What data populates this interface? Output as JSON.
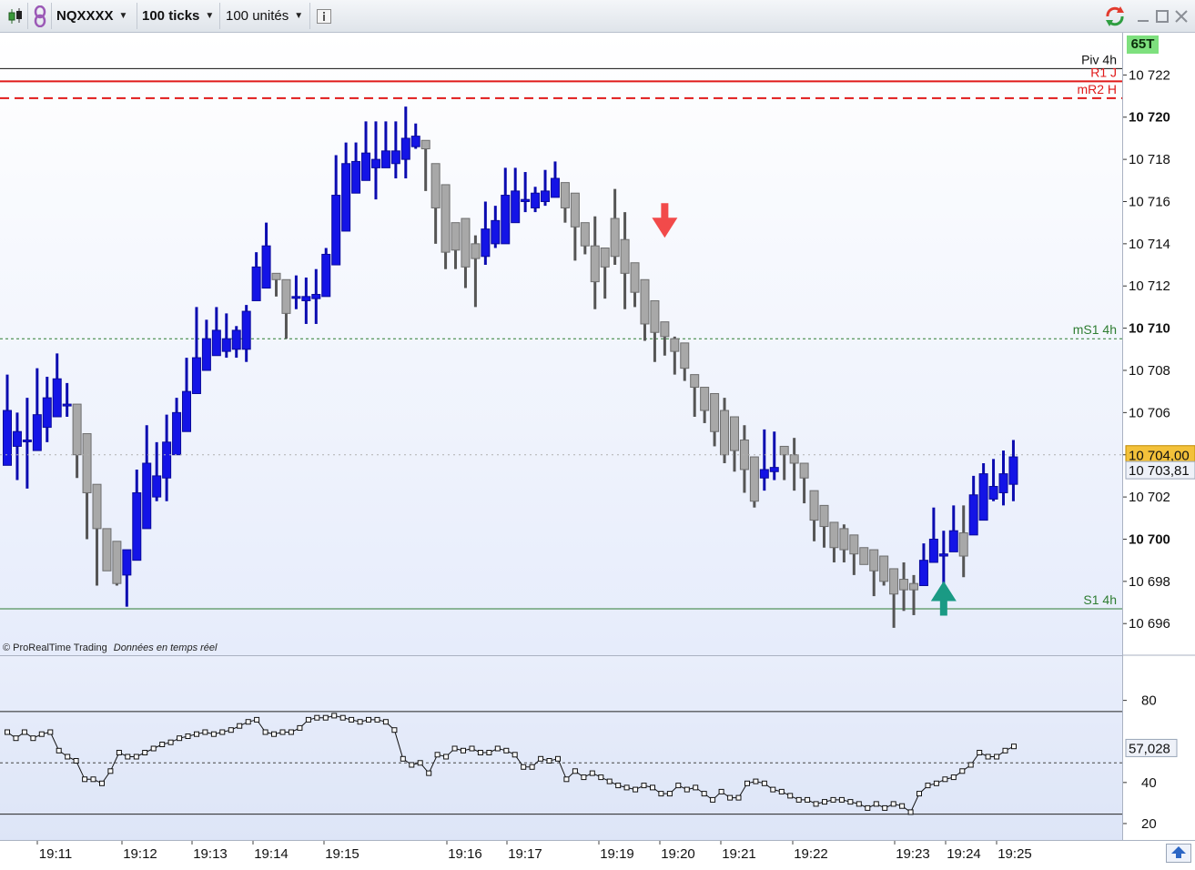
{
  "toolbar": {
    "instrument": "NQXXXX",
    "bar_type": "100 ticks",
    "volume_units": "100 unités",
    "info_icon": "info-icon",
    "chart_type_icon": "candlestick-icon",
    "link_icon": "link-icon",
    "refresh_icon": "refresh-icon",
    "minimize_icon": "minimize-icon",
    "maximize_icon": "maximize-icon",
    "close_icon": "close-icon"
  },
  "tick_count_badge": "65T",
  "colors": {
    "up_candle": "#1414e6",
    "down_candle": "#a8a8a8",
    "pivot_line": "#111111",
    "r1_line": "#e01a1a",
    "ms1_line": "#2e7d32",
    "current_price_bg": "#f3c13a"
  },
  "levels": [
    {
      "label": "Piv 4h",
      "value": 10722.3,
      "color": "#111111",
      "style": "solid"
    },
    {
      "label": "R1 J",
      "value": 10721.7,
      "color": "#e01a1a",
      "style": "solid"
    },
    {
      "label": "mR2 H",
      "value": 10720.9,
      "color": "#e01a1a",
      "style": "dashed"
    },
    {
      "label": "mS1 4h",
      "value": 10709.5,
      "color": "#2e7d32",
      "style": "dotted"
    },
    {
      "label": "S1 4h",
      "value": 10696.7,
      "color": "#2e7d32",
      "style": "solid"
    }
  ],
  "price_axis": {
    "min": 10694.5,
    "max": 10724.0,
    "ticks": [
      {
        "value": 10722,
        "label": "10 722",
        "bold": false
      },
      {
        "value": 10720,
        "label": "10 720",
        "bold": true
      },
      {
        "value": 10718,
        "label": "10 718",
        "bold": false
      },
      {
        "value": 10716,
        "label": "10 716",
        "bold": false
      },
      {
        "value": 10714,
        "label": "10 714",
        "bold": false
      },
      {
        "value": 10712,
        "label": "10 712",
        "bold": false
      },
      {
        "value": 10710,
        "label": "10 710",
        "bold": true
      },
      {
        "value": 10708,
        "label": "10 708",
        "bold": false
      },
      {
        "value": 10706,
        "label": "10 706",
        "bold": false
      },
      {
        "value": 10704,
        "label": "10 704",
        "bold": false
      },
      {
        "value": 10702,
        "label": "10 702",
        "bold": false
      },
      {
        "value": 10700,
        "label": "10 700",
        "bold": true
      },
      {
        "value": 10698,
        "label": "10 698",
        "bold": false
      },
      {
        "value": 10696,
        "label": "10 696",
        "bold": false
      }
    ],
    "current_price_label": "10 704,00",
    "current_price_value": 10704.0,
    "secondary_price_label": "10 703,81",
    "secondary_price_value": 10703.81
  },
  "rsi_axis": {
    "min": 12,
    "max": 102,
    "ticks": [
      {
        "value": 80,
        "label": "80"
      },
      {
        "value": 40,
        "label": "40"
      },
      {
        "value": 20,
        "label": "20"
      }
    ],
    "upper_band": 75,
    "lower_band": 25,
    "mid_line": 50,
    "current_value_label": "57,028",
    "current_value": 57.028
  },
  "time_axis": {
    "labels": [
      "19:11",
      "19:12",
      "19:13",
      "19:14",
      "19:15",
      "19:16",
      "19:17",
      "19:19",
      "19:20",
      "19:21",
      "19:22",
      "19:23",
      "19:24",
      "19:25"
    ]
  },
  "copyright": "© ProRealTime Trading",
  "data_status": "Données en temps réel",
  "annotations": [
    {
      "type": "arrow-down",
      "color": "#f24a4a",
      "bar_index": 66,
      "price": 10714.5
    },
    {
      "type": "arrow-up",
      "color": "#1a9a84",
      "bar_index": 94,
      "price": 10697.5
    }
  ],
  "chart_data": {
    "type": "candlestick",
    "title": "NQXXXX",
    "bar_interval": "100 ticks",
    "candles": [
      {
        "o": 10703.5,
        "h": 10707.8,
        "l": 10703.5,
        "c": 10706.1
      },
      {
        "o": 10704.4,
        "h": 10706.0,
        "l": 10702.8,
        "c": 10705.1
      },
      {
        "o": 10704.7,
        "h": 10706.7,
        "l": 10702.4,
        "c": 10704.7
      },
      {
        "o": 10704.2,
        "h": 10708.1,
        "l": 10704.2,
        "c": 10705.9
      },
      {
        "o": 10705.3,
        "h": 10707.7,
        "l": 10704.6,
        "c": 10706.7
      },
      {
        "o": 10705.8,
        "h": 10708.8,
        "l": 10705.8,
        "c": 10707.6
      },
      {
        "o": 10706.4,
        "h": 10707.4,
        "l": 10705.8,
        "c": 10706.4
      },
      {
        "o": 10706.4,
        "h": 10706.4,
        "l": 10702.9,
        "c": 10704.0
      },
      {
        "o": 10705.0,
        "h": 10705.0,
        "l": 10700.0,
        "c": 10702.2
      },
      {
        "o": 10702.6,
        "h": 10702.6,
        "l": 10697.8,
        "c": 10700.5
      },
      {
        "o": 10700.5,
        "h": 10700.5,
        "l": 10698.8,
        "c": 10698.5
      },
      {
        "o": 10699.9,
        "h": 10699.9,
        "l": 10697.8,
        "c": 10697.9
      },
      {
        "o": 10698.3,
        "h": 10699.5,
        "l": 10696.8,
        "c": 10699.5
      },
      {
        "o": 10699.0,
        "h": 10703.3,
        "l": 10699.0,
        "c": 10702.2
      },
      {
        "o": 10700.5,
        "h": 10705.4,
        "l": 10700.5,
        "c": 10703.6
      },
      {
        "o": 10702.0,
        "h": 10704.6,
        "l": 10701.8,
        "c": 10703.0
      },
      {
        "o": 10702.9,
        "h": 10705.9,
        "l": 10701.8,
        "c": 10704.6
      },
      {
        "o": 10704.0,
        "h": 10706.7,
        "l": 10704.0,
        "c": 10706.0
      },
      {
        "o": 10705.1,
        "h": 10708.6,
        "l": 10705.1,
        "c": 10707.0
      },
      {
        "o": 10706.9,
        "h": 10711.0,
        "l": 10706.9,
        "c": 10708.6
      },
      {
        "o": 10708.0,
        "h": 10710.4,
        "l": 10708.0,
        "c": 10709.5
      },
      {
        "o": 10708.7,
        "h": 10711.0,
        "l": 10708.7,
        "c": 10709.9
      },
      {
        "o": 10708.9,
        "h": 10710.7,
        "l": 10708.6,
        "c": 10709.5
      },
      {
        "o": 10709.0,
        "h": 10710.1,
        "l": 10708.6,
        "c": 10709.9
      },
      {
        "o": 10709.0,
        "h": 10711.1,
        "l": 10708.4,
        "c": 10710.8
      },
      {
        "o": 10711.3,
        "h": 10713.6,
        "l": 10711.3,
        "c": 10712.9
      },
      {
        "o": 10711.9,
        "h": 10715.0,
        "l": 10711.9,
        "c": 10713.9
      },
      {
        "o": 10712.6,
        "h": 10712.6,
        "l": 10711.5,
        "c": 10712.3
      },
      {
        "o": 10712.3,
        "h": 10712.3,
        "l": 10709.5,
        "c": 10710.7
      },
      {
        "o": 10711.5,
        "h": 10712.5,
        "l": 10710.9,
        "c": 10711.5
      },
      {
        "o": 10711.3,
        "h": 10712.4,
        "l": 10710.2,
        "c": 10711.5
      },
      {
        "o": 10711.4,
        "h": 10712.8,
        "l": 10710.2,
        "c": 10711.6
      },
      {
        "o": 10711.5,
        "h": 10713.8,
        "l": 10711.5,
        "c": 10713.5
      },
      {
        "o": 10713.0,
        "h": 10718.2,
        "l": 10713.0,
        "c": 10716.3
      },
      {
        "o": 10714.6,
        "h": 10718.8,
        "l": 10714.6,
        "c": 10717.8
      },
      {
        "o": 10716.4,
        "h": 10718.8,
        "l": 10716.4,
        "c": 10717.9
      },
      {
        "o": 10717.0,
        "h": 10719.8,
        "l": 10717.0,
        "c": 10718.3
      },
      {
        "o": 10717.6,
        "h": 10719.8,
        "l": 10716.1,
        "c": 10718.0
      },
      {
        "o": 10717.6,
        "h": 10719.8,
        "l": 10717.6,
        "c": 10718.4
      },
      {
        "o": 10717.8,
        "h": 10719.8,
        "l": 10717.1,
        "c": 10718.4
      },
      {
        "o": 10718.0,
        "h": 10720.5,
        "l": 10717.1,
        "c": 10719.0
      },
      {
        "o": 10718.6,
        "h": 10719.7,
        "l": 10718.5,
        "c": 10719.1
      },
      {
        "o": 10718.9,
        "h": 10718.9,
        "l": 10716.5,
        "c": 10718.5
      },
      {
        "o": 10717.8,
        "h": 10717.8,
        "l": 10714.0,
        "c": 10715.7
      },
      {
        "o": 10716.8,
        "h": 10716.8,
        "l": 10712.8,
        "c": 10713.6
      },
      {
        "o": 10715.0,
        "h": 10715.0,
        "l": 10712.8,
        "c": 10713.7
      },
      {
        "o": 10715.2,
        "h": 10715.2,
        "l": 10711.9,
        "c": 10712.9
      },
      {
        "o": 10714.0,
        "h": 10714.4,
        "l": 10711.0,
        "c": 10713.3
      },
      {
        "o": 10713.4,
        "h": 10716.0,
        "l": 10713.0,
        "c": 10714.7
      },
      {
        "o": 10714.0,
        "h": 10715.8,
        "l": 10713.8,
        "c": 10715.1
      },
      {
        "o": 10714.0,
        "h": 10717.6,
        "l": 10714.0,
        "c": 10716.3
      },
      {
        "o": 10715.0,
        "h": 10717.6,
        "l": 10715.0,
        "c": 10716.5
      },
      {
        "o": 10716.0,
        "h": 10717.4,
        "l": 10715.5,
        "c": 10716.1
      },
      {
        "o": 10715.7,
        "h": 10716.7,
        "l": 10715.5,
        "c": 10716.4
      },
      {
        "o": 10716.0,
        "h": 10717.5,
        "l": 10715.8,
        "c": 10716.5
      },
      {
        "o": 10716.2,
        "h": 10717.9,
        "l": 10716.2,
        "c": 10717.1
      },
      {
        "o": 10716.9,
        "h": 10716.9,
        "l": 10715.0,
        "c": 10715.7
      },
      {
        "o": 10716.4,
        "h": 10716.4,
        "l": 10713.2,
        "c": 10714.8
      },
      {
        "o": 10715.0,
        "h": 10715.0,
        "l": 10713.5,
        "c": 10713.9
      },
      {
        "o": 10713.9,
        "h": 10715.3,
        "l": 10710.9,
        "c": 10712.2
      },
      {
        "o": 10713.8,
        "h": 10713.8,
        "l": 10711.4,
        "c": 10712.9
      },
      {
        "o": 10715.2,
        "h": 10716.6,
        "l": 10713.0,
        "c": 10713.4
      },
      {
        "o": 10714.2,
        "h": 10715.5,
        "l": 10710.9,
        "c": 10712.6
      },
      {
        "o": 10713.1,
        "h": 10713.1,
        "l": 10711.0,
        "c": 10711.7
      },
      {
        "o": 10712.3,
        "h": 10712.3,
        "l": 10709.4,
        "c": 10710.2
      },
      {
        "o": 10711.3,
        "h": 10711.3,
        "l": 10708.4,
        "c": 10709.8
      },
      {
        "o": 10710.3,
        "h": 10710.3,
        "l": 10708.7,
        "c": 10709.6
      },
      {
        "o": 10709.5,
        "h": 10709.6,
        "l": 10707.8,
        "c": 10708.9
      },
      {
        "o": 10709.3,
        "h": 10709.3,
        "l": 10707.5,
        "c": 10708.1
      },
      {
        "o": 10707.8,
        "h": 10707.8,
        "l": 10705.8,
        "c": 10707.2
      },
      {
        "o": 10707.2,
        "h": 10707.2,
        "l": 10705.5,
        "c": 10706.1
      },
      {
        "o": 10706.9,
        "h": 10706.9,
        "l": 10704.4,
        "c": 10705.1
      },
      {
        "o": 10706.1,
        "h": 10706.7,
        "l": 10703.6,
        "c": 10704.0
      },
      {
        "o": 10705.8,
        "h": 10705.8,
        "l": 10703.2,
        "c": 10704.2
      },
      {
        "o": 10704.7,
        "h": 10705.4,
        "l": 10702.2,
        "c": 10703.3
      },
      {
        "o": 10703.9,
        "h": 10703.9,
        "l": 10701.5,
        "c": 10701.8
      },
      {
        "o": 10702.9,
        "h": 10705.2,
        "l": 10702.3,
        "c": 10703.3
      },
      {
        "o": 10703.2,
        "h": 10705.1,
        "l": 10702.8,
        "c": 10703.4
      },
      {
        "o": 10704.4,
        "h": 10704.4,
        "l": 10702.8,
        "c": 10704.0
      },
      {
        "o": 10704.0,
        "h": 10704.8,
        "l": 10702.3,
        "c": 10703.6
      },
      {
        "o": 10703.6,
        "h": 10703.6,
        "l": 10701.7,
        "c": 10702.9
      },
      {
        "o": 10702.3,
        "h": 10702.3,
        "l": 10699.9,
        "c": 10700.9
      },
      {
        "o": 10701.6,
        "h": 10701.6,
        "l": 10699.6,
        "c": 10700.6
      },
      {
        "o": 10700.8,
        "h": 10700.8,
        "l": 10698.9,
        "c": 10699.6
      },
      {
        "o": 10700.5,
        "h": 10700.7,
        "l": 10698.9,
        "c": 10699.5
      },
      {
        "o": 10700.2,
        "h": 10700.2,
        "l": 10698.3,
        "c": 10699.3
      },
      {
        "o": 10699.6,
        "h": 10699.6,
        "l": 10698.8,
        "c": 10698.8
      },
      {
        "o": 10699.5,
        "h": 10699.5,
        "l": 10697.3,
        "c": 10698.5
      },
      {
        "o": 10699.2,
        "h": 10699.2,
        "l": 10697.8,
        "c": 10698.0
      },
      {
        "o": 10698.6,
        "h": 10698.6,
        "l": 10695.8,
        "c": 10697.4
      },
      {
        "o": 10698.1,
        "h": 10698.9,
        "l": 10696.6,
        "c": 10697.6
      },
      {
        "o": 10697.9,
        "h": 10698.3,
        "l": 10696.4,
        "c": 10697.6
      },
      {
        "o": 10697.8,
        "h": 10699.8,
        "l": 10697.8,
        "c": 10699.0
      },
      {
        "o": 10698.9,
        "h": 10701.5,
        "l": 10698.9,
        "c": 10700.0
      },
      {
        "o": 10699.2,
        "h": 10700.4,
        "l": 10697.8,
        "c": 10699.3
      },
      {
        "o": 10699.4,
        "h": 10701.6,
        "l": 10699.4,
        "c": 10700.4
      },
      {
        "o": 10700.3,
        "h": 10701.6,
        "l": 10698.2,
        "c": 10699.2
      },
      {
        "o": 10700.2,
        "h": 10703.0,
        "l": 10700.2,
        "c": 10702.1
      },
      {
        "o": 10700.9,
        "h": 10703.6,
        "l": 10700.9,
        "c": 10703.1
      },
      {
        "o": 10701.9,
        "h": 10703.8,
        "l": 10701.8,
        "c": 10702.5
      },
      {
        "o": 10702.2,
        "h": 10704.2,
        "l": 10701.6,
        "c": 10703.1
      },
      {
        "o": 10702.6,
        "h": 10704.7,
        "l": 10701.8,
        "c": 10703.9
      }
    ],
    "rsi": [
      65,
      62,
      65,
      62,
      64,
      65,
      56,
      53,
      51,
      42,
      42,
      40,
      46,
      55,
      53,
      53,
      55,
      57,
      59,
      60,
      62,
      63,
      64,
      65,
      64,
      65,
      66,
      68,
      70,
      71,
      65,
      64,
      65,
      65,
      67,
      71,
      72,
      72,
      73,
      72,
      71,
      70,
      71,
      71,
      70,
      66,
      52,
      49,
      50,
      45,
      54,
      53,
      57,
      56,
      57,
      55,
      55,
      57,
      56,
      54,
      48,
      48,
      52,
      51,
      52,
      42,
      46,
      43,
      45,
      43,
      41,
      39,
      38,
      37,
      39,
      38,
      35,
      35,
      39,
      37,
      38,
      35,
      32,
      36,
      33,
      33,
      40,
      41,
      40,
      37,
      36,
      34,
      32,
      32,
      30,
      31,
      32,
      32,
      31,
      30,
      28,
      30,
      28,
      30,
      29,
      26,
      35,
      39,
      40,
      42,
      43,
      46,
      49,
      55,
      53,
      53,
      56,
      58
    ]
  }
}
